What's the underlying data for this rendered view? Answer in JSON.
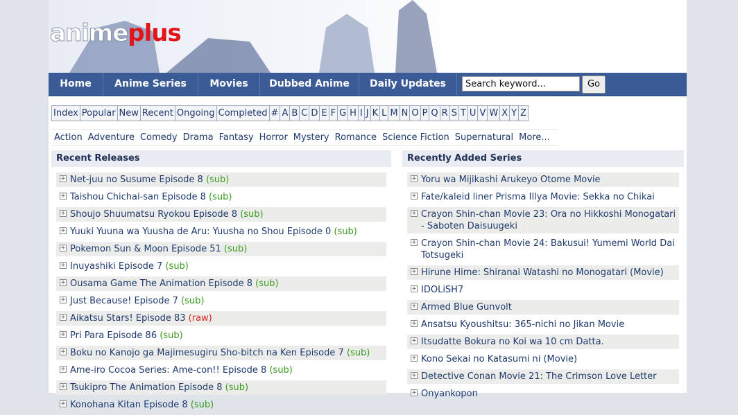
{
  "logo": {
    "part1": "anime",
    "part2": "plus"
  },
  "nav": {
    "items": [
      "Home",
      "Anime Series",
      "Movies",
      "Dubbed Anime",
      "Daily Updates"
    ],
    "search_placeholder": "Search keyword...",
    "go_label": "Go"
  },
  "alphabet": [
    "Index",
    "Popular",
    "New",
    "Recent",
    "Ongoing",
    "Completed",
    "#",
    "A",
    "B",
    "C",
    "D",
    "E",
    "F",
    "G",
    "H",
    "I",
    "J",
    "K",
    "L",
    "M",
    "N",
    "O",
    "P",
    "Q",
    "R",
    "S",
    "T",
    "U",
    "V",
    "W",
    "X",
    "Y",
    "Z"
  ],
  "genres": [
    "Action",
    "Adventure",
    "Comedy",
    "Drama",
    "Fantasy",
    "Horror",
    "Mystery",
    "Romance",
    "Science Fiction",
    "Supernatural",
    "More..."
  ],
  "recent_releases": {
    "title": "Recent Releases",
    "items": [
      {
        "title": "Net-juu no Susume Episode 8",
        "tag": "(sub)",
        "type": "sub"
      },
      {
        "title": "Taishou Chichai-san Episode 8",
        "tag": "(sub)",
        "type": "sub"
      },
      {
        "title": "Shoujo Shuumatsu Ryokou Episode 8",
        "tag": "(sub)",
        "type": "sub"
      },
      {
        "title": "Yuuki Yuuna wa Yuusha de Aru: Yuusha no Shou Episode 0",
        "tag": "(sub)",
        "type": "sub"
      },
      {
        "title": "Pokemon Sun & Moon Episode 51",
        "tag": "(sub)",
        "type": "sub"
      },
      {
        "title": "Inuyashiki Episode 7",
        "tag": "(sub)",
        "type": "sub"
      },
      {
        "title": "Ousama Game The Animation Episode 8",
        "tag": "(sub)",
        "type": "sub"
      },
      {
        "title": "Just Because! Episode 7",
        "tag": "(sub)",
        "type": "sub"
      },
      {
        "title": "Aikatsu Stars! Episode 83",
        "tag": "(raw)",
        "type": "raw"
      },
      {
        "title": "Pri Para Episode 86",
        "tag": "(sub)",
        "type": "sub"
      },
      {
        "title": "Boku no Kanojo ga Majimesugiru Sho-bitch na Ken Episode 7",
        "tag": "(sub)",
        "type": "sub"
      },
      {
        "title": "Ame-iro Cocoa Series: Ame-con!! Episode 8",
        "tag": "(sub)",
        "type": "sub"
      },
      {
        "title": "Tsukipro The Animation Episode 8",
        "tag": "(sub)",
        "type": "sub"
      },
      {
        "title": "Konohana Kitan Episode 8",
        "tag": "(sub)",
        "type": "sub"
      }
    ]
  },
  "recently_added": {
    "title": "Recently Added Series",
    "items": [
      "Yoru wa Mijikashi Arukeyo Otome Movie",
      "Fate/kaleid liner Prisma Illya Movie: Sekka no Chikai",
      "Crayon Shin-chan Movie 23: Ora no Hikkoshi Monogatari - Saboten Daisuugeki",
      "Crayon Shin-chan Movie 24: Bakusui! Yumemi World Dai Totsugeki",
      "Hirune Hime: Shiranai Watashi no Monogatari (Movie)",
      "IDOLiSH7",
      "Armed Blue Gunvolt",
      "Ansatsu Kyoushitsu: 365-nichi no Jikan Movie",
      "Itsudatte Bokura no Koi wa 10 cm Datta.",
      "Kono Sekai no Katasumi ni (Movie)",
      "Detective Conan Movie 21: The Crimson Love Letter",
      "Onyankopon"
    ]
  },
  "colors": {
    "nav": "#3b5b96",
    "sub": "#3a9a1e",
    "raw": "#d9271f",
    "link": "#1f3a6e"
  }
}
